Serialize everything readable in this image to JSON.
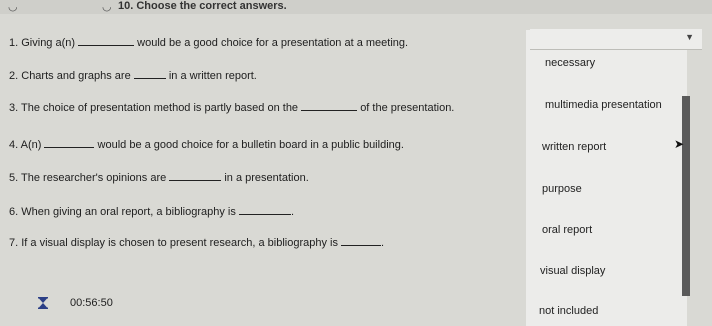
{
  "header": {
    "title": "10. Choose the correct answers."
  },
  "questions": [
    {
      "number": "1.",
      "before": "Giving a(n)",
      "after": "would be a good choice for a presentation at a meeting."
    },
    {
      "number": "2.",
      "before": "Charts and graphs are",
      "after": "in a written report."
    },
    {
      "number": "3.",
      "before": "The choice of presentation method is partly based on the",
      "after": "of the presentation."
    },
    {
      "number": "4.",
      "before": "A(n)",
      "after": "would be a good choice for a bulletin board in a public building."
    },
    {
      "number": "5.",
      "before": "The researcher's opinions are",
      "after": "in a presentation."
    },
    {
      "number": "6.",
      "before": "When giving an oral report, a bibliography is",
      "after": "."
    },
    {
      "number": "7.",
      "before": "If a visual display is chosen to present research, a bibliography is",
      "after": "."
    }
  ],
  "timer": {
    "value": "00:56:50"
  },
  "dropdown": {
    "options": [
      "necessary",
      "multimedia presentation",
      "written report",
      "purpose",
      "oral report",
      "visual display",
      "not included"
    ]
  }
}
